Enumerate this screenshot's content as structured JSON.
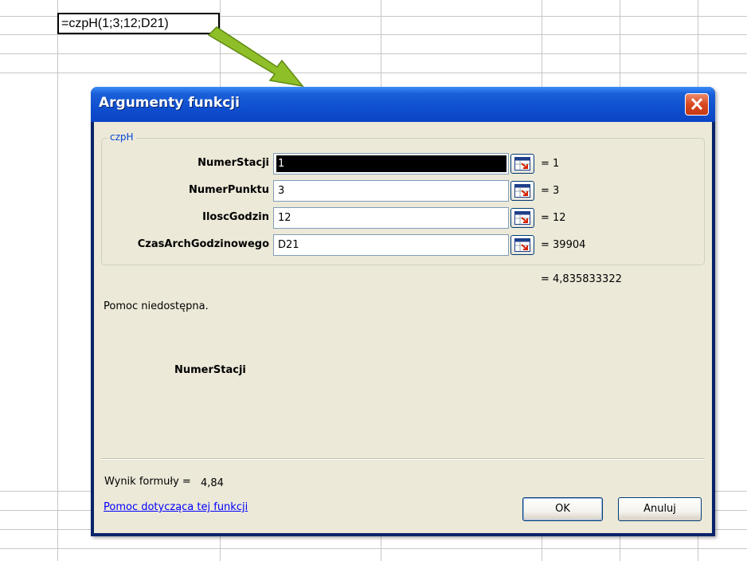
{
  "spreadsheet": {
    "cell_formula": "=czpH(1;3;12;D21)"
  },
  "dialog": {
    "title": "Argumenty funkcji",
    "function_name": "czpH",
    "arguments": [
      {
        "label": "NumerStacji",
        "input": "1",
        "value": "= 1"
      },
      {
        "label": "NumerPunktu",
        "input": "3",
        "value": "= 3"
      },
      {
        "label": "IloscGodzin",
        "input": "12",
        "value": "= 12"
      },
      {
        "label": "CzasArchGodzinowego",
        "input": "D21",
        "value": "= 39904"
      }
    ],
    "result": "= 4,835833322",
    "help_text": "Pomoc niedostępna.",
    "current_param": "NumerStacji",
    "formula_result_label": "Wynik formuły =",
    "formula_result_value": "4,84",
    "help_link": "Pomoc dotycząca tej funkcji",
    "ok_label": "OK",
    "cancel_label": "Anuluj"
  },
  "colors": {
    "titlebar": "#0f4fd0",
    "dialog_bg": "#ece9d8",
    "link": "#0000ff",
    "arrow": "#8fbf28"
  },
  "icons": [
    "close-icon",
    "cell-reference-icon",
    "callout-arrow"
  ]
}
